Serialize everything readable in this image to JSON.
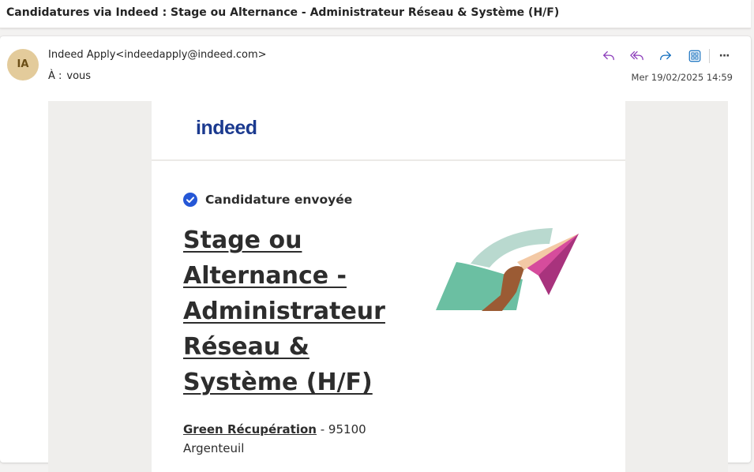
{
  "subject": "Candidatures via Indeed : Stage ou Alternance - Administrateur Réseau & Système (H/F)",
  "sender": {
    "initials": "IA",
    "display": "Indeed Apply<indeedapply@indeed.com>",
    "to_label": "À :",
    "to_value": "vous",
    "date": "Mer 19/02/2025 14:59"
  },
  "toolbar": {
    "icons": [
      "reply-icon",
      "reply-all-icon",
      "forward-icon",
      "apps-icon",
      "more-icon"
    ],
    "more_label": "···"
  },
  "email": {
    "logo_text": "indeed",
    "status_text": "Candidature envoyée",
    "job_title": "Stage ou Alternance - Administrateur Réseau & Système (H/F)",
    "company": "Green Récupération",
    "location": " - 95100 Argenteuil"
  },
  "colors": {
    "accent": "#1b3a8f",
    "check": "#2557d6",
    "action_purple": "#8a3ab9",
    "action_blue": "#0f6cbd"
  }
}
